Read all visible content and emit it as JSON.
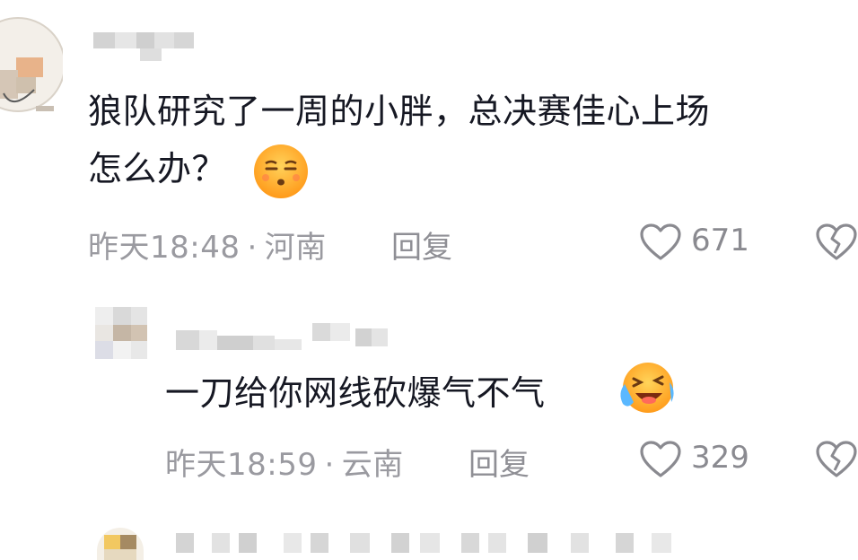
{
  "comments": [
    {
      "text_line1": "狼队研究了一周的小胖，总决赛佳心上场",
      "text_line2": "怎么办？",
      "emoji": "smirk-emoji",
      "time": "昨天18:48",
      "location": "河南",
      "reply_label": "回复",
      "likes": "671"
    },
    {
      "text": "一刀给你网线砍爆气不气",
      "emoji": "laughing-crying-emoji",
      "time": "昨天18:59",
      "location": "云南",
      "reply_label": "回复",
      "likes": "329"
    }
  ],
  "separator": "·"
}
